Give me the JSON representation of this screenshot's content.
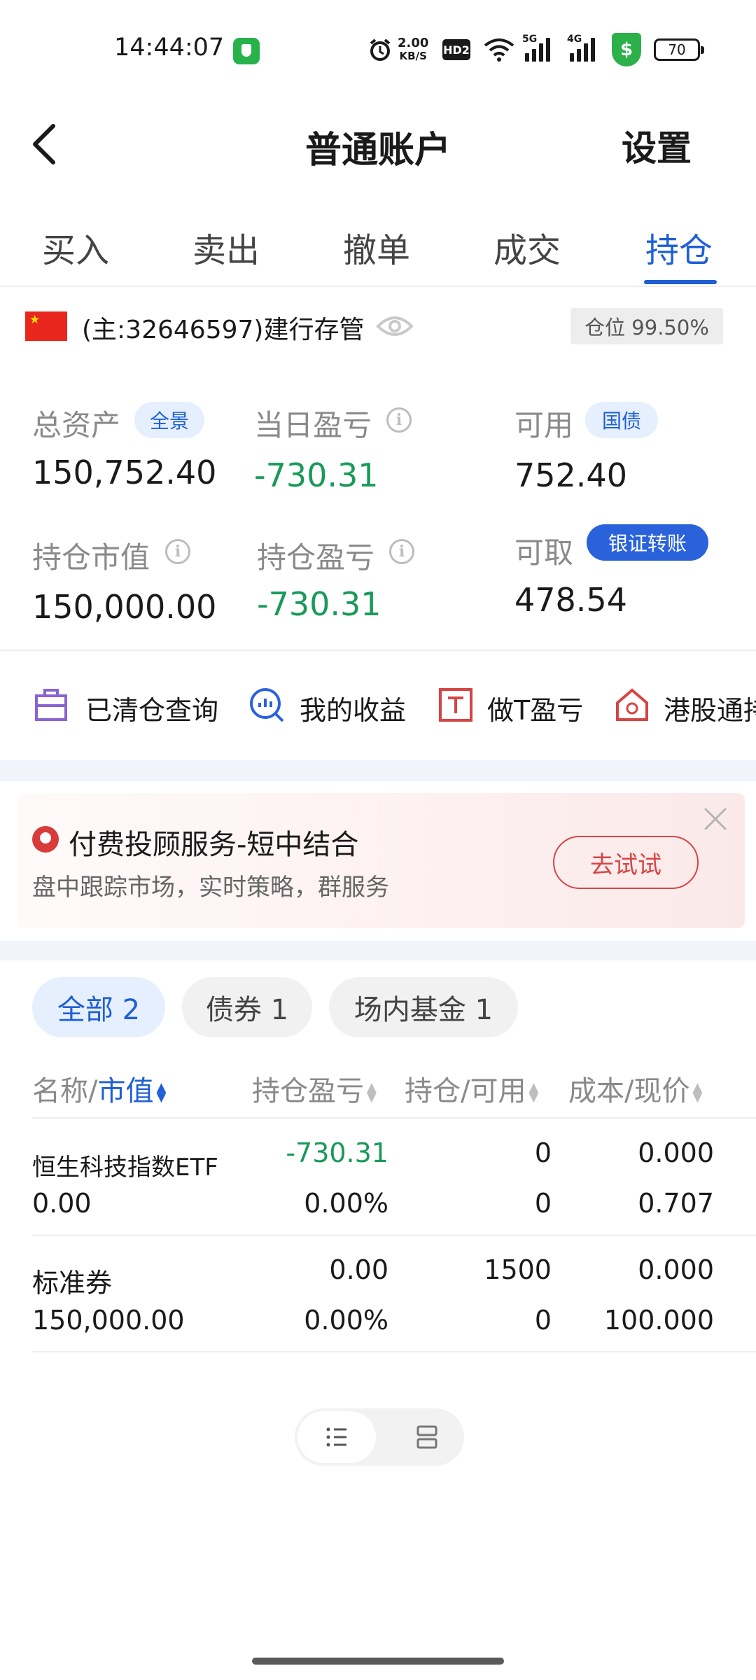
{
  "status_bar": {
    "time": "14:44:07",
    "net_speed_value": "2.00",
    "net_speed_unit": "KB/S",
    "hd": "HD2",
    "sig1": "5G",
    "sig2": "4G",
    "shield": "$",
    "battery": "70"
  },
  "nav": {
    "title": "普通账户",
    "settings": "设置"
  },
  "tabs": [
    "买入",
    "卖出",
    "撤单",
    "成交",
    "持仓"
  ],
  "account": {
    "text": "(主:32646597)建行存管",
    "position": "仓位 99.50%"
  },
  "metrics": {
    "total_assets": {
      "label": "总资产",
      "chip": "全景",
      "value": "150,752.40"
    },
    "daily_pl": {
      "label": "当日盈亏",
      "value": "-730.31"
    },
    "available": {
      "label": "可用",
      "chip": "国债",
      "value": "752.40"
    },
    "market_value": {
      "label": "持仓市值",
      "value": "150,000.00"
    },
    "position_pl": {
      "label": "持仓盈亏",
      "value": "-730.31"
    },
    "withdrawable": {
      "label": "可取",
      "chip": "银证转账",
      "value": "478.54"
    }
  },
  "shortcuts": [
    "已清仓查询",
    "我的收益",
    "做T盈亏",
    "港股通持"
  ],
  "ad": {
    "title": "付费投顾服务-短中结合",
    "subtitle": "盘中跟踪市场，实时策略，群服务",
    "button": "去试试"
  },
  "filters": [
    "全部 2",
    "债券 1",
    "场内基金 1"
  ],
  "table": {
    "headers": {
      "name": "名称/",
      "value": "市值",
      "pl": "持仓盈亏",
      "hold": "持仓/可用",
      "cost": "成本/现价"
    },
    "rows": [
      {
        "name": "恒生科技指数ETF",
        "market_value": "0.00",
        "pl": "-730.31",
        "pl_pct": "0.00%",
        "hold": "0",
        "avail": "0",
        "cost": "0.000",
        "price": "0.707"
      },
      {
        "name": "标准券",
        "market_value": "150,000.00",
        "pl": "0.00",
        "pl_pct": "0.00%",
        "hold": "1500",
        "avail": "0",
        "cost": "0.000",
        "price": "100.000"
      }
    ]
  },
  "colors": {
    "accent": "#1f5fd6",
    "loss": "#1a9a5a",
    "promo": "#d64545"
  }
}
